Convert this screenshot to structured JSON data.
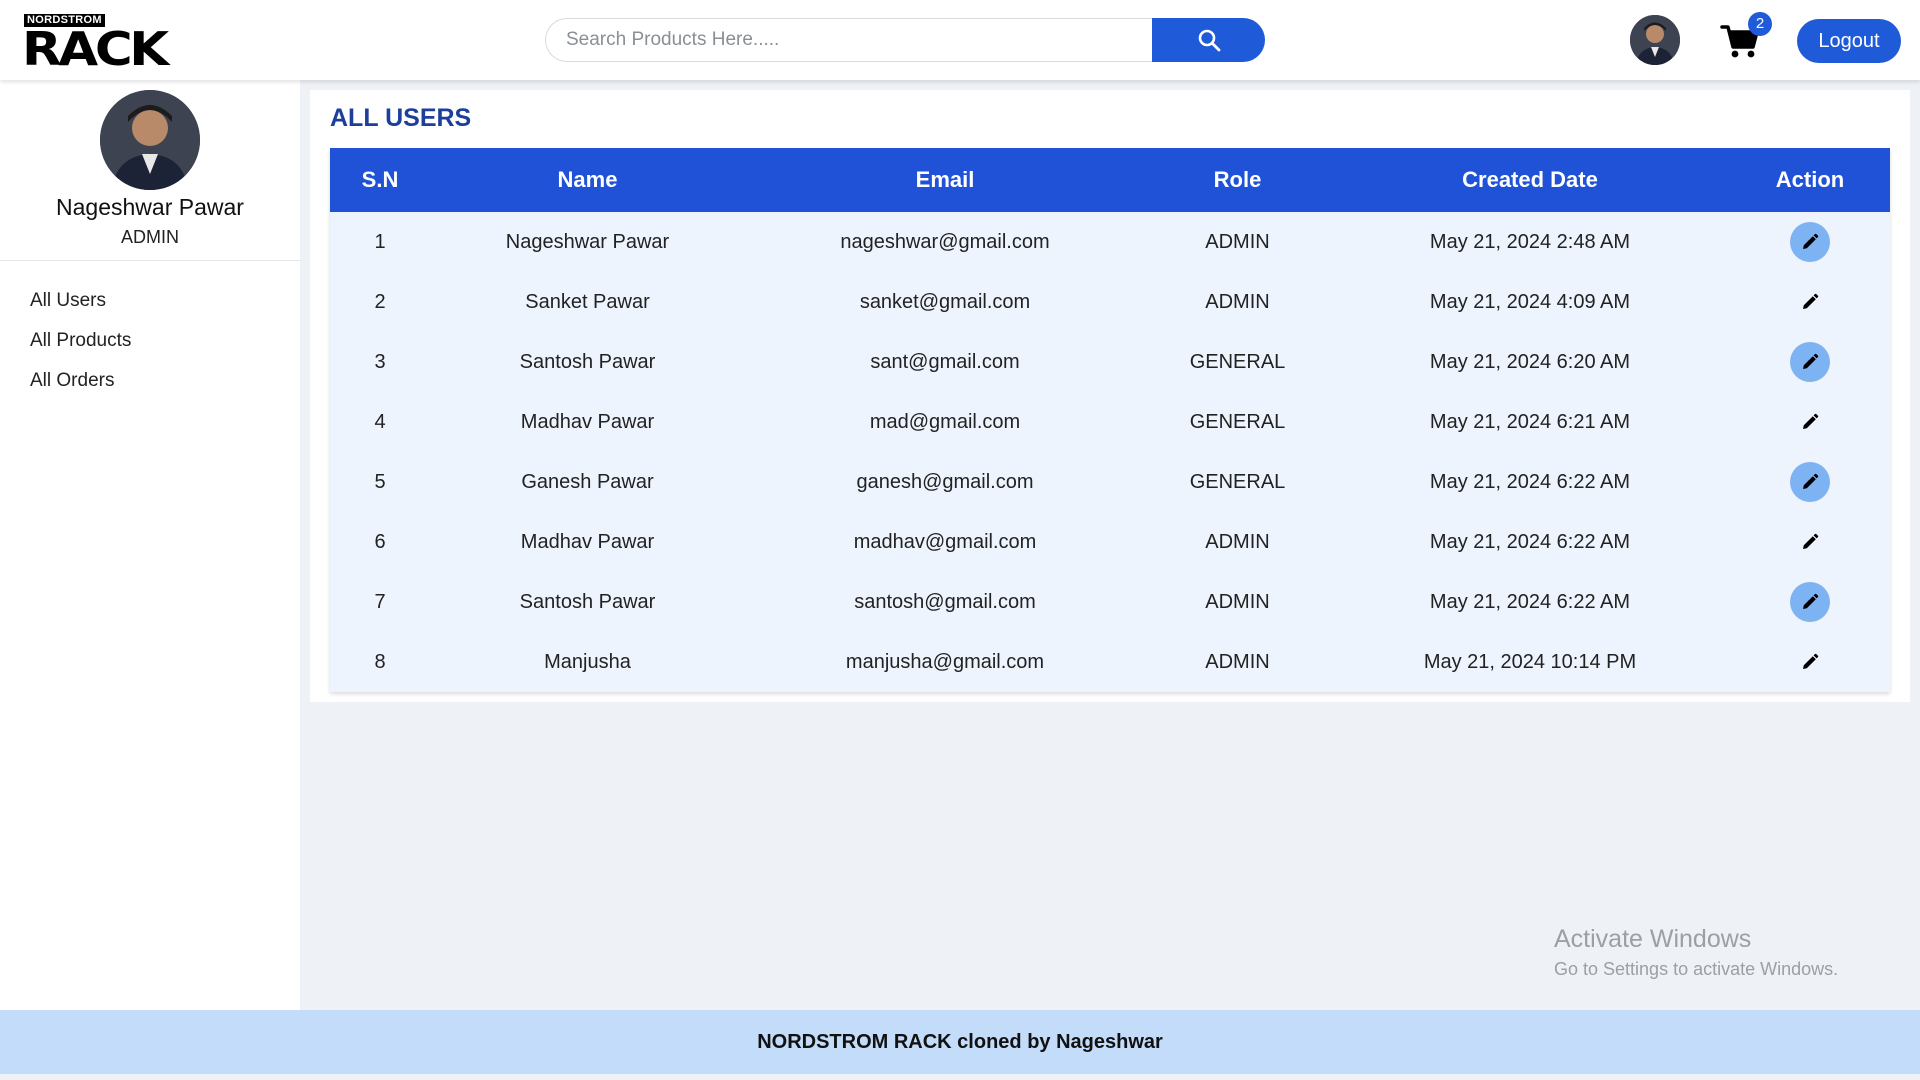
{
  "brand": {
    "small_text": "NORDSTROM",
    "big_text": "RACK"
  },
  "header": {
    "search_placeholder": "Search Products Here.....",
    "cart_count": "2",
    "logout_label": "Logout"
  },
  "sidebar": {
    "user_name": "Nageshwar Pawar",
    "user_role": "ADMIN",
    "items": [
      {
        "label": "All Users"
      },
      {
        "label": "All Products"
      },
      {
        "label": "All Orders"
      }
    ]
  },
  "main": {
    "title": "ALL USERS",
    "columns": [
      "S.N",
      "Name",
      "Email",
      "Role",
      "Created Date",
      "Action"
    ],
    "rows": [
      {
        "sn": "1",
        "name": "Nageshwar Pawar",
        "email": "nageshwar@gmail.com",
        "role": "ADMIN",
        "created": "May 21, 2024 2:48 AM"
      },
      {
        "sn": "2",
        "name": "Sanket Pawar",
        "email": "sanket@gmail.com",
        "role": "ADMIN",
        "created": "May 21, 2024 4:09 AM"
      },
      {
        "sn": "3",
        "name": "Santosh Pawar",
        "email": "sant@gmail.com",
        "role": "GENERAL",
        "created": "May 21, 2024 6:20 AM"
      },
      {
        "sn": "4",
        "name": "Madhav Pawar",
        "email": "mad@gmail.com",
        "role": "GENERAL",
        "created": "May 21, 2024 6:21 AM"
      },
      {
        "sn": "5",
        "name": "Ganesh Pawar",
        "email": "ganesh@gmail.com",
        "role": "GENERAL",
        "created": "May 21, 2024 6:22 AM"
      },
      {
        "sn": "6",
        "name": "Madhav Pawar",
        "email": "madhav@gmail.com",
        "role": "ADMIN",
        "created": "May 21, 2024 6:22 AM"
      },
      {
        "sn": "7",
        "name": "Santosh Pawar",
        "email": "santosh@gmail.com",
        "role": "ADMIN",
        "created": "May 21, 2024 6:22 AM"
      },
      {
        "sn": "8",
        "name": "Manjusha",
        "email": "manjusha@gmail.com",
        "role": "ADMIN",
        "created": "May 21, 2024 10:14 PM"
      }
    ],
    "action_icon": "pencil-icon"
  },
  "watermark": {
    "line1": "Activate Windows",
    "line2": "Go to Settings to activate Windows."
  },
  "footer": {
    "text": "NORDSTROM RACK cloned by Nageshwar"
  },
  "colors": {
    "primary": "#1f5bd9",
    "table_header": "#1f52d6",
    "row_bg": "#eef4fe",
    "edit_button": "#7eb3f3",
    "footer_bg": "#c2dcfa",
    "title": "#1d3f9c"
  }
}
